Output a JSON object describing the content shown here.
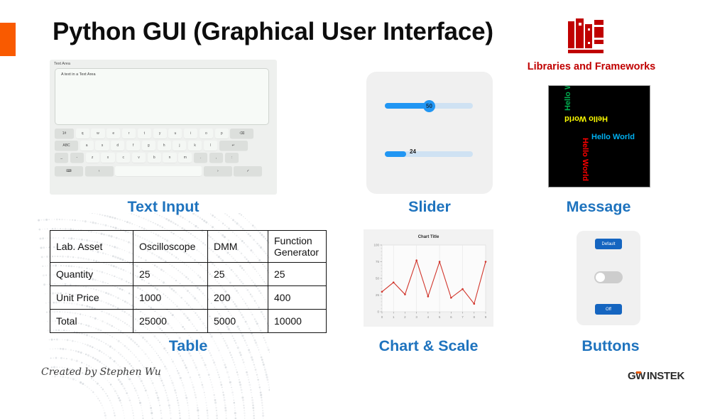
{
  "slide": {
    "title": "Python GUI (Graphical User Interface)",
    "accent_orange": "#F95A00",
    "caption_blue": "#1E73BE",
    "libraries_red": "#C00000",
    "signature": "Created by Stephen Wu",
    "brand": {
      "gw": "GW",
      "instek": "INSTEK"
    }
  },
  "libraries": {
    "icon": "books-icon",
    "caption": "Libraries and Frameworks"
  },
  "captions": {
    "text_input": "Text Input",
    "slider": "Slider",
    "message": "Message",
    "table": "Table",
    "chart": "Chart & Scale",
    "buttons": "Buttons"
  },
  "text_input": {
    "field_label": "Text Area",
    "field_value": "A text in a Text Area",
    "keyboard": {
      "row1": [
        "1#",
        "q",
        "w",
        "e",
        "r",
        "t",
        "y",
        "u",
        "i",
        "o",
        "p",
        "⌫"
      ],
      "row2": [
        "ABC",
        "a",
        "s",
        "d",
        "f",
        "g",
        "h",
        "j",
        "k",
        "l",
        "↵"
      ],
      "row3": [
        "_",
        "-",
        "z",
        "x",
        "c",
        "v",
        "b",
        "n",
        "m",
        ".",
        ",",
        ":"
      ],
      "row4": [
        "⌨",
        "‹",
        "",
        "›",
        "✓"
      ]
    }
  },
  "slider": {
    "first": {
      "value": "50",
      "percent": 50
    },
    "second": {
      "value": "24",
      "percent": 24
    },
    "fill_color": "#2196f3",
    "track_color": "#cfe2f3"
  },
  "message": {
    "items": [
      {
        "text": "Hello World",
        "color": "#00B0F0",
        "rotation": 0
      },
      {
        "text": "Hello World",
        "color": "#00B050",
        "rotation": -90
      },
      {
        "text": "Hello World",
        "color": "#FFFF00",
        "rotation": 180
      },
      {
        "text": "Hello World",
        "color": "#FF0000",
        "rotation": 90
      }
    ],
    "background": "#000000"
  },
  "table": {
    "rows": [
      [
        "Lab. Asset",
        "Oscilloscope",
        "DMM",
        "Function Generator"
      ],
      [
        "Quantity",
        "25",
        "25",
        "25"
      ],
      [
        "Unit Price",
        "1000",
        "200",
        "400"
      ],
      [
        "Total",
        "25000",
        "5000",
        "10000"
      ]
    ]
  },
  "chart_data": {
    "type": "line",
    "title": "Chart Title",
    "x": [
      0,
      1,
      2,
      3,
      4,
      5,
      6,
      7,
      8,
      9
    ],
    "values": [
      30,
      44,
      26,
      77,
      23,
      75,
      21,
      34,
      12,
      75
    ],
    "xlabel": "",
    "ylabel": "",
    "ylim": [
      0,
      100
    ],
    "xlim": [
      0,
      9
    ],
    "yticks": [
      0,
      25,
      50,
      75,
      100
    ],
    "xticks": [
      0,
      1,
      2,
      3,
      4,
      5,
      6,
      7,
      8,
      9
    ],
    "line_color": "#D1352B",
    "marker": "circle",
    "grid": true,
    "legend": false
  },
  "buttons": {
    "top_label": "Default",
    "bottom_label": "Off",
    "toggle_state": "off",
    "button_color": "#1565C0"
  }
}
